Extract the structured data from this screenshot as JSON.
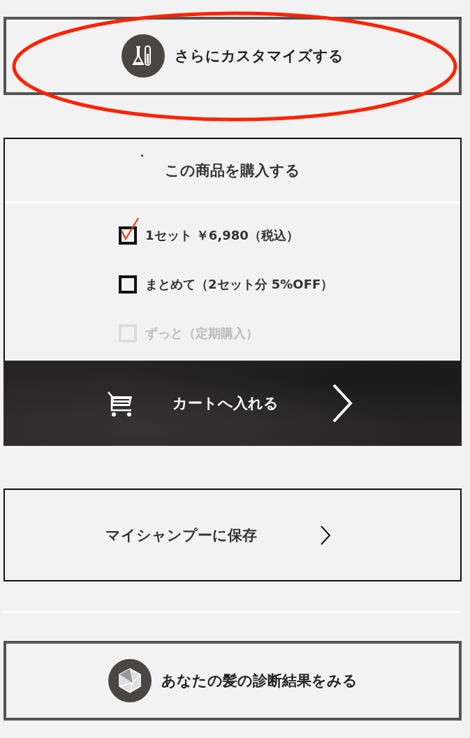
{
  "customize_button": {
    "label": "さらにカスタマイズする",
    "annotated": true
  },
  "purchase": {
    "title": "この商品を購入する",
    "options": [
      {
        "label": "1セット ￥6,980（税込）",
        "checked": true,
        "disabled": false
      },
      {
        "label": "まとめて（2セット分 5%OFF）",
        "checked": false,
        "disabled": false
      },
      {
        "label": "ずっと（定期購入）",
        "checked": false,
        "disabled": true
      }
    ],
    "cart_button": {
      "label": "カートへ入れる"
    }
  },
  "save_button": {
    "label": "マイシャンプーに保存"
  },
  "diagnosis_button": {
    "label": "あなたの髪の診断結果をみる"
  }
}
